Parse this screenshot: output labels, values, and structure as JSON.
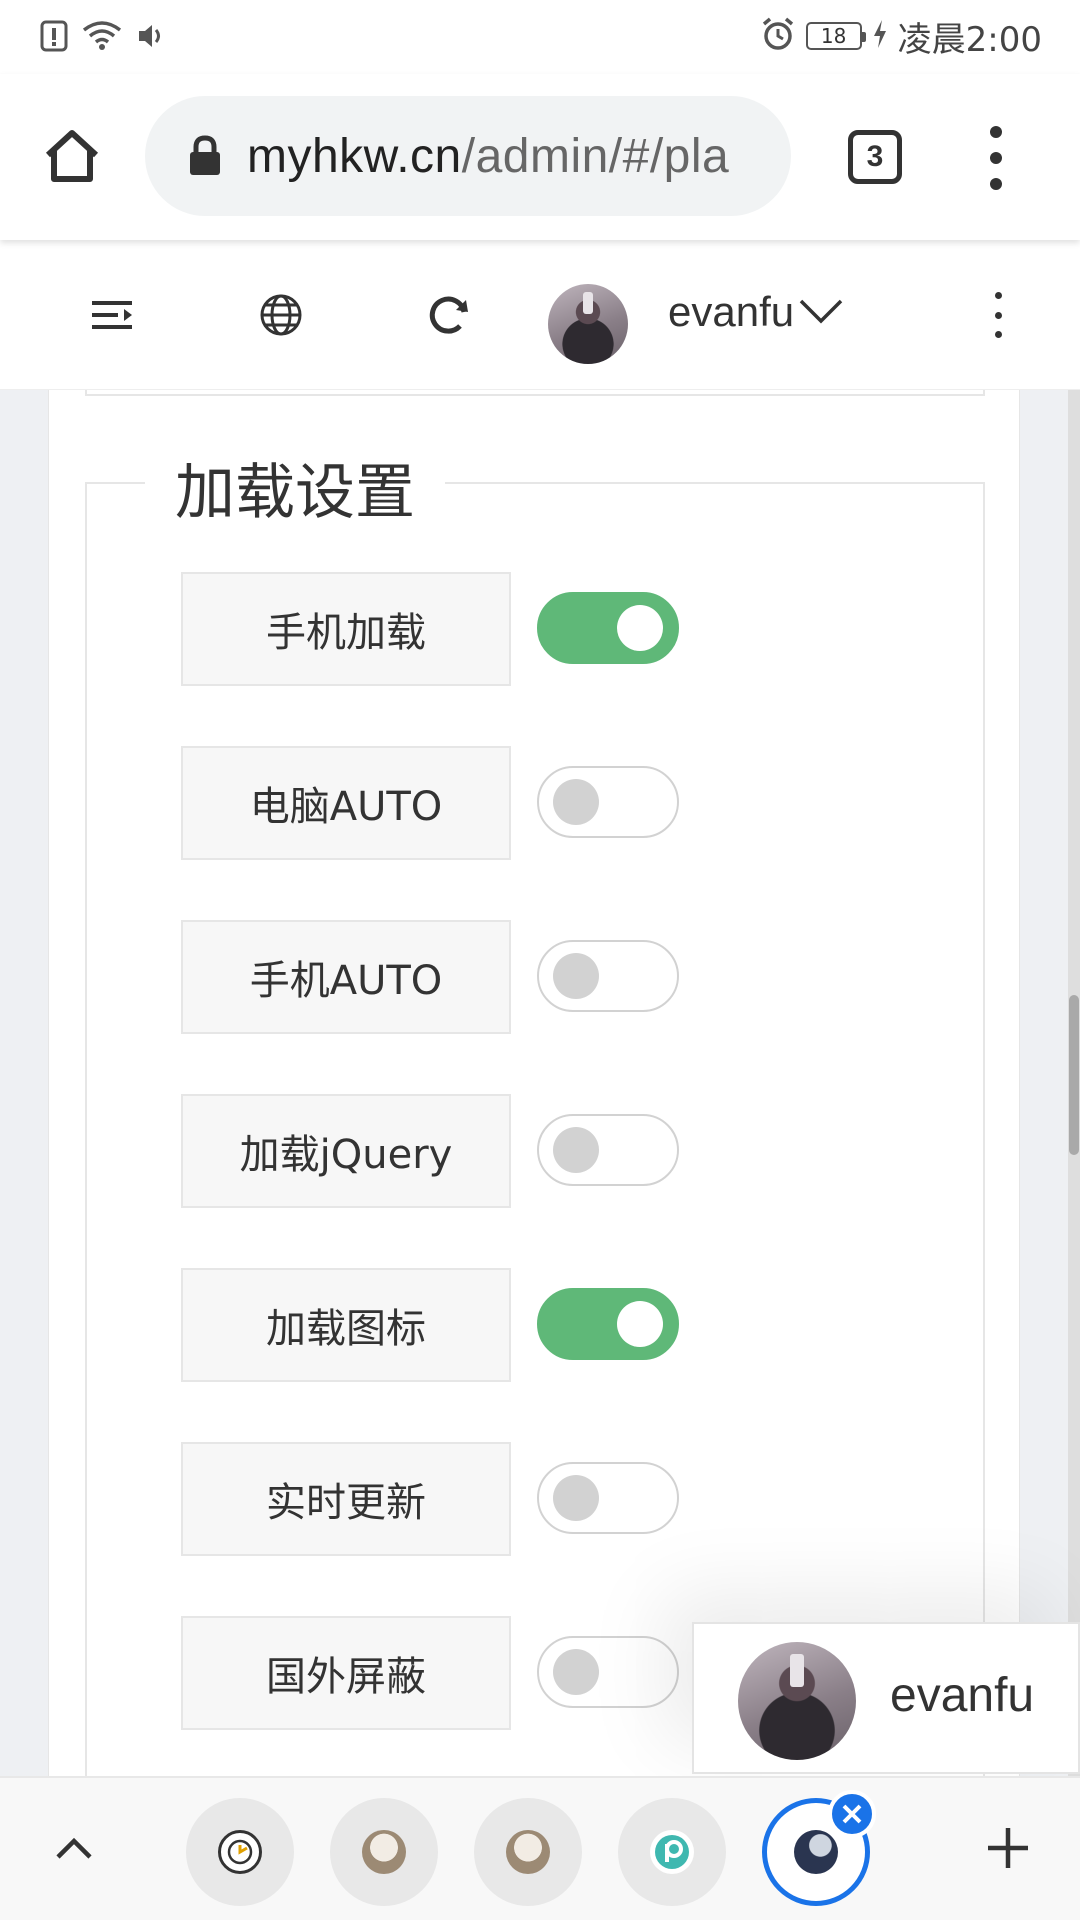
{
  "status_bar": {
    "time": "凌晨2:00",
    "battery": "18",
    "icons": [
      "alert-icon",
      "wifi-icon",
      "volume-icon",
      "alarm-icon",
      "battery-icon",
      "charging-icon"
    ]
  },
  "browser": {
    "url_host": "myhkw.cn",
    "url_path": "/admin/#/pla",
    "tab_count": "3",
    "icons": [
      "home-icon",
      "lock-icon",
      "overflow-menu-icon"
    ]
  },
  "admin_header": {
    "username": "evanfu",
    "icons": [
      "menu-toggle-icon",
      "globe-icon",
      "refresh-icon",
      "chevron-down-icon",
      "more-icon"
    ]
  },
  "section": {
    "title": "加载设置",
    "settings": [
      {
        "label": "手机加载",
        "enabled": true
      },
      {
        "label": "电脑AUTO",
        "enabled": false
      },
      {
        "label": "手机AUTO",
        "enabled": false
      },
      {
        "label": "加载jQuery",
        "enabled": false
      },
      {
        "label": "加载图标",
        "enabled": true
      },
      {
        "label": "实时更新",
        "enabled": false
      },
      {
        "label": "国外屏蔽",
        "enabled": false
      }
    ]
  },
  "user_card": {
    "username": "evanfu"
  },
  "bottom_bar": {
    "tabs": [
      "tab-1",
      "tab-2",
      "tab-3",
      "tab-4",
      "tab-5-active"
    ],
    "icons": [
      "chevron-up-icon",
      "close-icon",
      "plus-icon"
    ]
  },
  "colors": {
    "toggle_on": "#5fb878",
    "toggle_off": "#d2d2d2",
    "accent": "#1a73e8"
  }
}
